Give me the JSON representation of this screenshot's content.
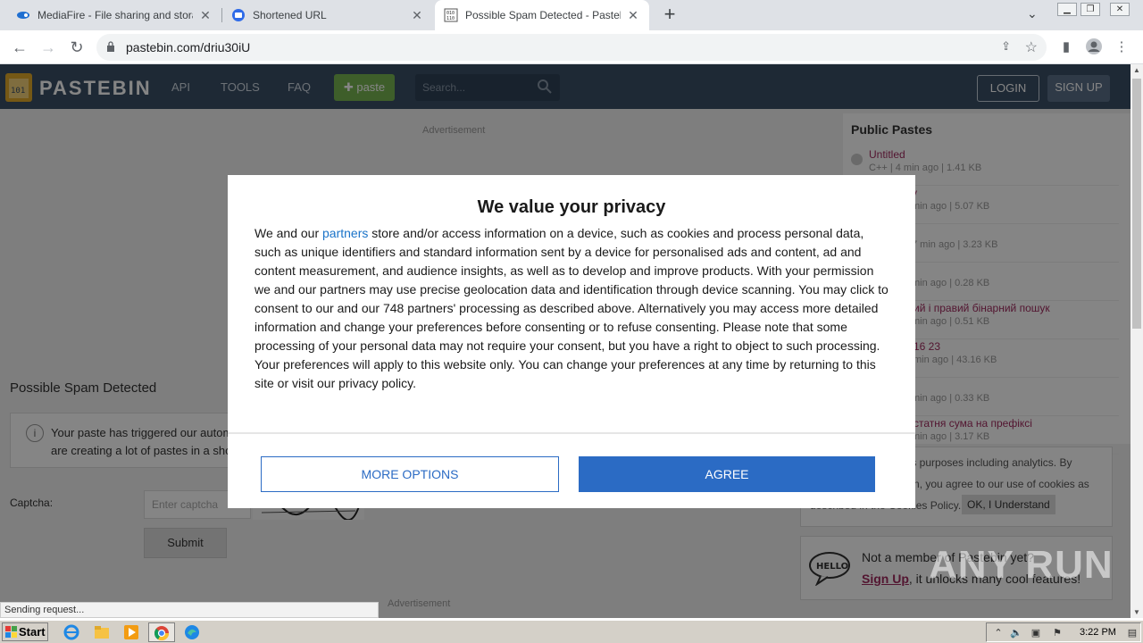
{
  "browser": {
    "tabs": [
      {
        "title": "MediaFire - File sharing and storage ...",
        "active": false
      },
      {
        "title": "Shortened URL",
        "active": false
      },
      {
        "title": "Possible Spam Detected - Pastebin.com",
        "active": true
      }
    ],
    "url": "pastebin.com/driu30iU"
  },
  "pastebin": {
    "brand": "PASTEBIN",
    "nav": [
      "API",
      "TOOLS",
      "FAQ"
    ],
    "paste_button": "paste",
    "search_placeholder": "Search...",
    "login": "LOGIN",
    "signup": "SIGN UP",
    "advertisement": "Advertisement",
    "heading": "Possible Spam Detected",
    "notice_line1": "Your paste has triggered our automatic SPAM detection filter. Please fill in the captcha below if you",
    "notice_line2": "are creating a lot of pastes in a short period of time.",
    "captcha_label": "Captcha:",
    "captcha_placeholder": "Enter captcha",
    "submit": "Submit",
    "public_pastes_title": "Public Pastes",
    "public_pastes": [
      {
        "name": "Untitled",
        "meta": "C++ | 4 min ago | 1.41 KB"
      },
      {
        "name": "y",
        "meta": "min ago | 5.07 KB"
      },
      {
        "name": "",
        "meta": "7 min ago | 3.23 KB"
      },
      {
        "name": "",
        "meta": "min ago | 0.28 KB"
      },
      {
        "name": "ий і правий бінарний пошук",
        "meta": "min ago | 0.51 KB"
      },
      {
        "name": "16 23",
        "meta": "min ago | 43.16 KB"
      },
      {
        "name": "",
        "meta": "min ago | 0.33 KB"
      },
      {
        "name": "статня сума на префіксі",
        "meta": "min ago | 3.17 KB"
      }
    ],
    "cookie_l1": "ous purposes including analytics. By",
    "cookie_l2": "ebin, you agree to our use of cookies as",
    "cookie_l3": "described in the Cookies Policy.",
    "cookie_ok": "OK, I Understand",
    "member_q": "Not a member of Pastebin yet?",
    "member_signup": "Sign Up",
    "member_rest": ", it unlocks many cool features!"
  },
  "status_bubble": "Sending request...",
  "consent": {
    "title": "We value your privacy",
    "body_before": "We and our ",
    "partners_link": "partners",
    "body_after": " store and/or access information on a device, such as cookies and process personal data, such as unique identifiers and standard information sent by a device for personalised ads and content, ad and content measurement, and audience insights, as well as to develop and improve products. With your permission we and our partners may use precise geolocation data and identification through device scanning. You may click to consent to our and our 748 partners' processing as described above. Alternatively you may access more detailed information and change your preferences before consenting or to refuse consenting. Please note that some processing of your personal data may not require your consent, but you have a right to object to such processing. Your preferences will apply to this website only. You can change your preferences at any time by returning to this site or visit our privacy policy.",
    "more_options": "MORE OPTIONS",
    "agree": "AGREE"
  },
  "watermark": "ANY RUN",
  "taskbar": {
    "start": "Start",
    "clock": "3:22 PM"
  },
  "colors": {
    "pastebin_header": "#3b4f66",
    "accent_blue": "#2b6bc4",
    "link_pink": "#a02b5e"
  }
}
